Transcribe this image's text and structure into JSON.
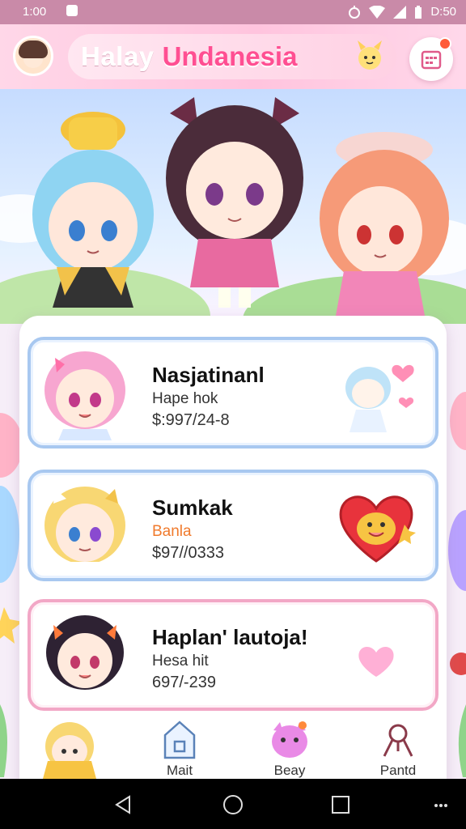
{
  "status_bar": {
    "time": "1:00",
    "battery": "D:50",
    "icons": [
      "timer-icon",
      "wifi-icon",
      "signal-icon",
      "battery-icon"
    ]
  },
  "header": {
    "title_plain": "Halay",
    "title_accent": "Undanesia",
    "colors": {
      "accent": "#ff4f92",
      "header_bg": "#ffc4de"
    }
  },
  "cards": [
    {
      "name": "Nasjatinanl",
      "subtitle": "Hape hok",
      "price": "$:997/24-8",
      "style": "blue",
      "decor": "heart-icon"
    },
    {
      "name": "Sumkak",
      "subtitle": "Banla",
      "price": "$97//0333",
      "style": "blue",
      "decor": "heart-icon"
    },
    {
      "name": "Haplan' lautoja!",
      "subtitle": "Hesa hit",
      "price": "697/-239",
      "style": "pink",
      "decor": "heart-icon"
    }
  ],
  "bottom_nav": [
    {
      "label": "",
      "icon": "character-icon"
    },
    {
      "label": "Mait",
      "icon": "house-icon"
    },
    {
      "label": "Beay",
      "icon": "pet-icon"
    },
    {
      "label": "Pantd",
      "icon": "ribbon-icon"
    }
  ],
  "android_nav": [
    "back-icon",
    "home-icon",
    "recents-icon",
    "more-icon"
  ]
}
